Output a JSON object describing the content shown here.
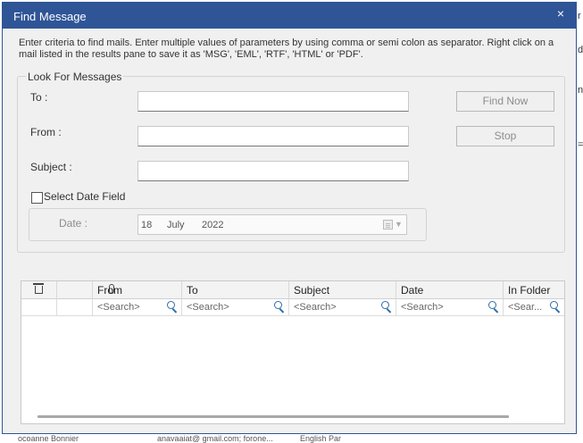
{
  "window": {
    "title": "Find Message",
    "close_glyph": "×"
  },
  "description": "Enter criteria to find mails. Enter multiple values of parameters by using comma or semi colon as separator. Right click on a mail listed in the results pane to save it as 'MSG', 'EML', 'RTF', 'HTML' or 'PDF'.",
  "look_for": {
    "legend": "Look For Messages",
    "to_label": "To :",
    "from_label": "From :",
    "subject_label": "Subject :",
    "to_value": "",
    "from_value": "",
    "subject_value": "",
    "find_now": "Find Now",
    "stop": "Stop",
    "select_date_label": "Select Date Field",
    "select_date_checked": false,
    "date_label": "Date :",
    "date": {
      "day": "18",
      "month": "July",
      "year": "2022"
    }
  },
  "results": {
    "columns": [
      "From",
      "To",
      "Subject",
      "Date",
      "In Folder"
    ],
    "search_placeholders": [
      "<Search>",
      "<Search>",
      "<Search>",
      "<Search>",
      "<Sear..."
    ],
    "icons": [
      "trash-icon",
      "attachment-icon",
      "search-icon"
    ]
  },
  "background": {
    "bottom_fragments": [
      "ocoanne Bonnier",
      "anavaaiat@ gmail.com; forone...",
      "English Par"
    ],
    "right_fragments": [
      "r",
      "d",
      "n",
      "="
    ]
  }
}
